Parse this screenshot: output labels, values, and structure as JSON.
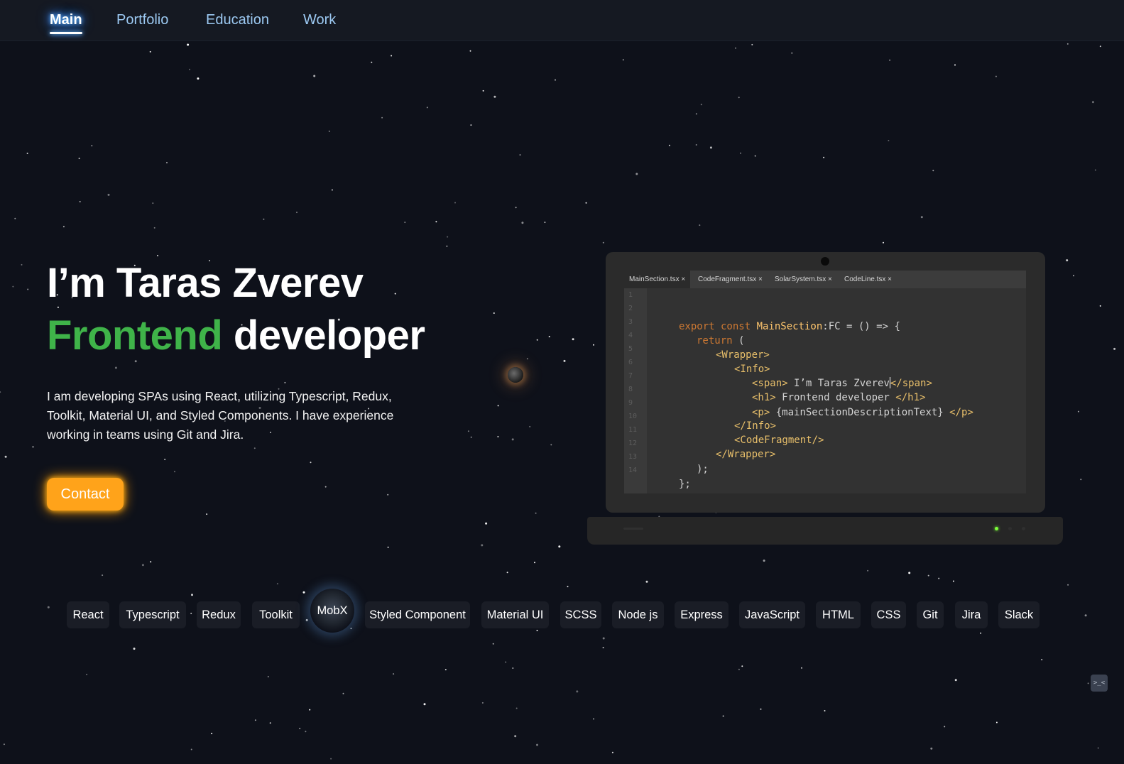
{
  "nav": {
    "items": [
      {
        "label": "Main",
        "active": true
      },
      {
        "label": "Portfolio",
        "active": false
      },
      {
        "label": "Education",
        "active": false
      },
      {
        "label": "Work",
        "active": false
      }
    ]
  },
  "hero": {
    "name_line": "I’m Taras Zverev",
    "role_highlight": "Frontend",
    "role_rest": "developer",
    "description": "I am developing SPAs using React, utilizing Typescript, Redux, Toolkit, Material UI, and Styled Components. I have experience working in teams using Git and Jira.",
    "contact_label": "Contact"
  },
  "editor": {
    "tabs": [
      "MainSection.tsx ×",
      "CodeFragment.tsx ×",
      "SolarSystem.tsx ×",
      "CodeLine.tsx ×"
    ],
    "line_numbers": [
      "1",
      "2",
      "3",
      "4",
      "5",
      "6",
      "7",
      "8",
      "9",
      "10",
      "11",
      "12",
      "13",
      "14"
    ],
    "code": {
      "l1_kw": "export const ",
      "l1_fn": "MainSection",
      "l1_rest": ":FC = () => {",
      "l2_kw": "return",
      "l2_rest": " (",
      "l3": "<Wrapper>",
      "l4": "<Info>",
      "l5_open": "<span>",
      "l5_text": " I’m Taras Zverev",
      "l5_close": "</span>",
      "l6_open": "<h1>",
      "l6_text": " Frontend developer ",
      "l6_close": "</h1>",
      "l7_open": "<p>",
      "l7_text": " {mainSectionDescriptionText} ",
      "l7_close": "</p>",
      "l8": "</Info>",
      "l9": "<CodeFragment/>",
      "l10": "</Wrapper>",
      "l11": ");",
      "l12": "};"
    }
  },
  "skills": [
    "React",
    "Typescript",
    "Redux",
    "Toolkit",
    "MobX",
    "Styled Component",
    "Material UI",
    "SCSS",
    "Node js",
    "Express",
    "JavaScript",
    "HTML",
    "CSS",
    "Git",
    "Jira",
    "Slack"
  ],
  "corner_icon": ">_<",
  "colors": {
    "background": "#0e111a",
    "nav": "#151922",
    "accent_green": "#3fb349",
    "contact_orange": "#ffa31a",
    "nav_link": "#9cc9f2"
  }
}
